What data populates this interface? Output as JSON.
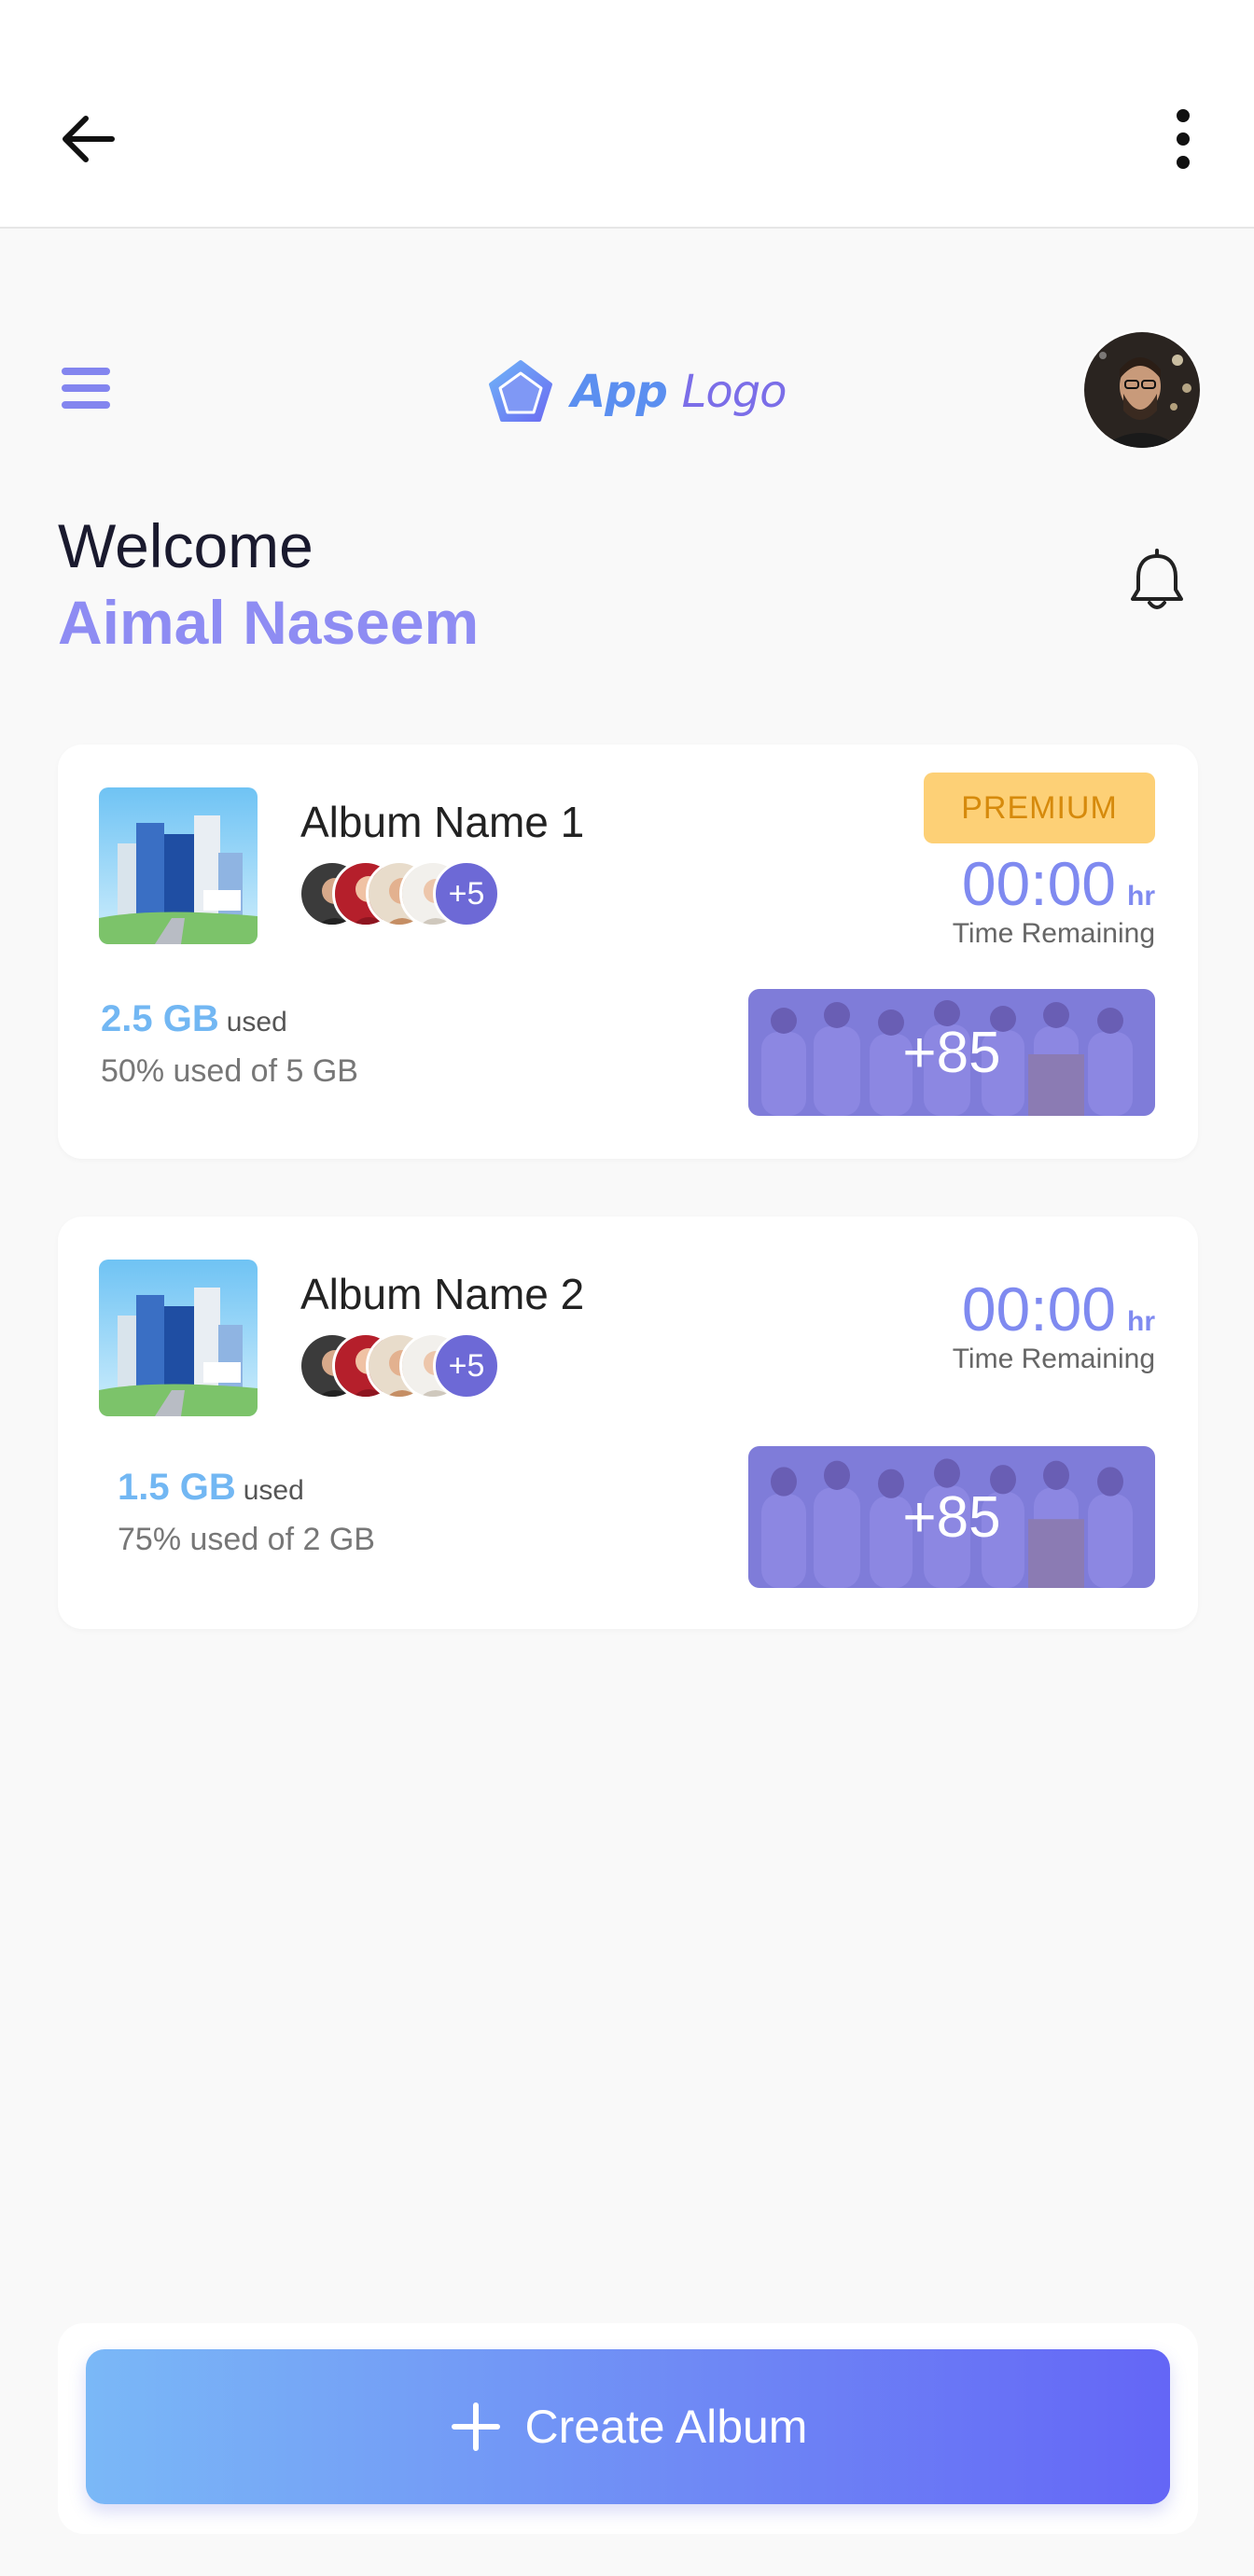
{
  "app": {
    "logo_text_first": "App",
    "logo_text_second": "Logo"
  },
  "welcome": {
    "greeting": "Welcome",
    "user_name": "Aimal Naseem"
  },
  "albums": [
    {
      "title": "Album Name 1",
      "badge": "PREMIUM",
      "members_more": "+5",
      "timer_value": "00:00",
      "timer_unit": "hr",
      "timer_label": "Time Remaining",
      "storage_used": "2.5 GB",
      "storage_used_suffix": "used",
      "storage_detail": "50% used of 5 GB",
      "storage_fraction": 0.5,
      "photos_count": "+85"
    },
    {
      "title": "Album Name 2",
      "members_more": "+5",
      "timer_value": "00:00",
      "timer_unit": "hr",
      "timer_label": "Time Remaining",
      "storage_used": "1.5 GB",
      "storage_used_suffix": "used",
      "storage_detail": "75% used of 2 GB",
      "storage_fraction": 0.75,
      "photos_count": "+85"
    }
  ],
  "actions": {
    "create_album_label": "Create Album"
  },
  "colors": {
    "accent_purple": "#8e8cf3",
    "accent_blue": "#72b7f3",
    "premium_bg": "#fdd076",
    "premium_text": "#d68a0c",
    "button_gradient_start": "#7ab8f7",
    "button_gradient_end": "#6466f6"
  },
  "icons": {
    "back": "arrow-left-icon",
    "more": "vertical-dots-icon",
    "menu": "hamburger-icon",
    "logo": "pentagon-logo-icon",
    "bell": "bell-icon",
    "plus": "plus-icon"
  }
}
